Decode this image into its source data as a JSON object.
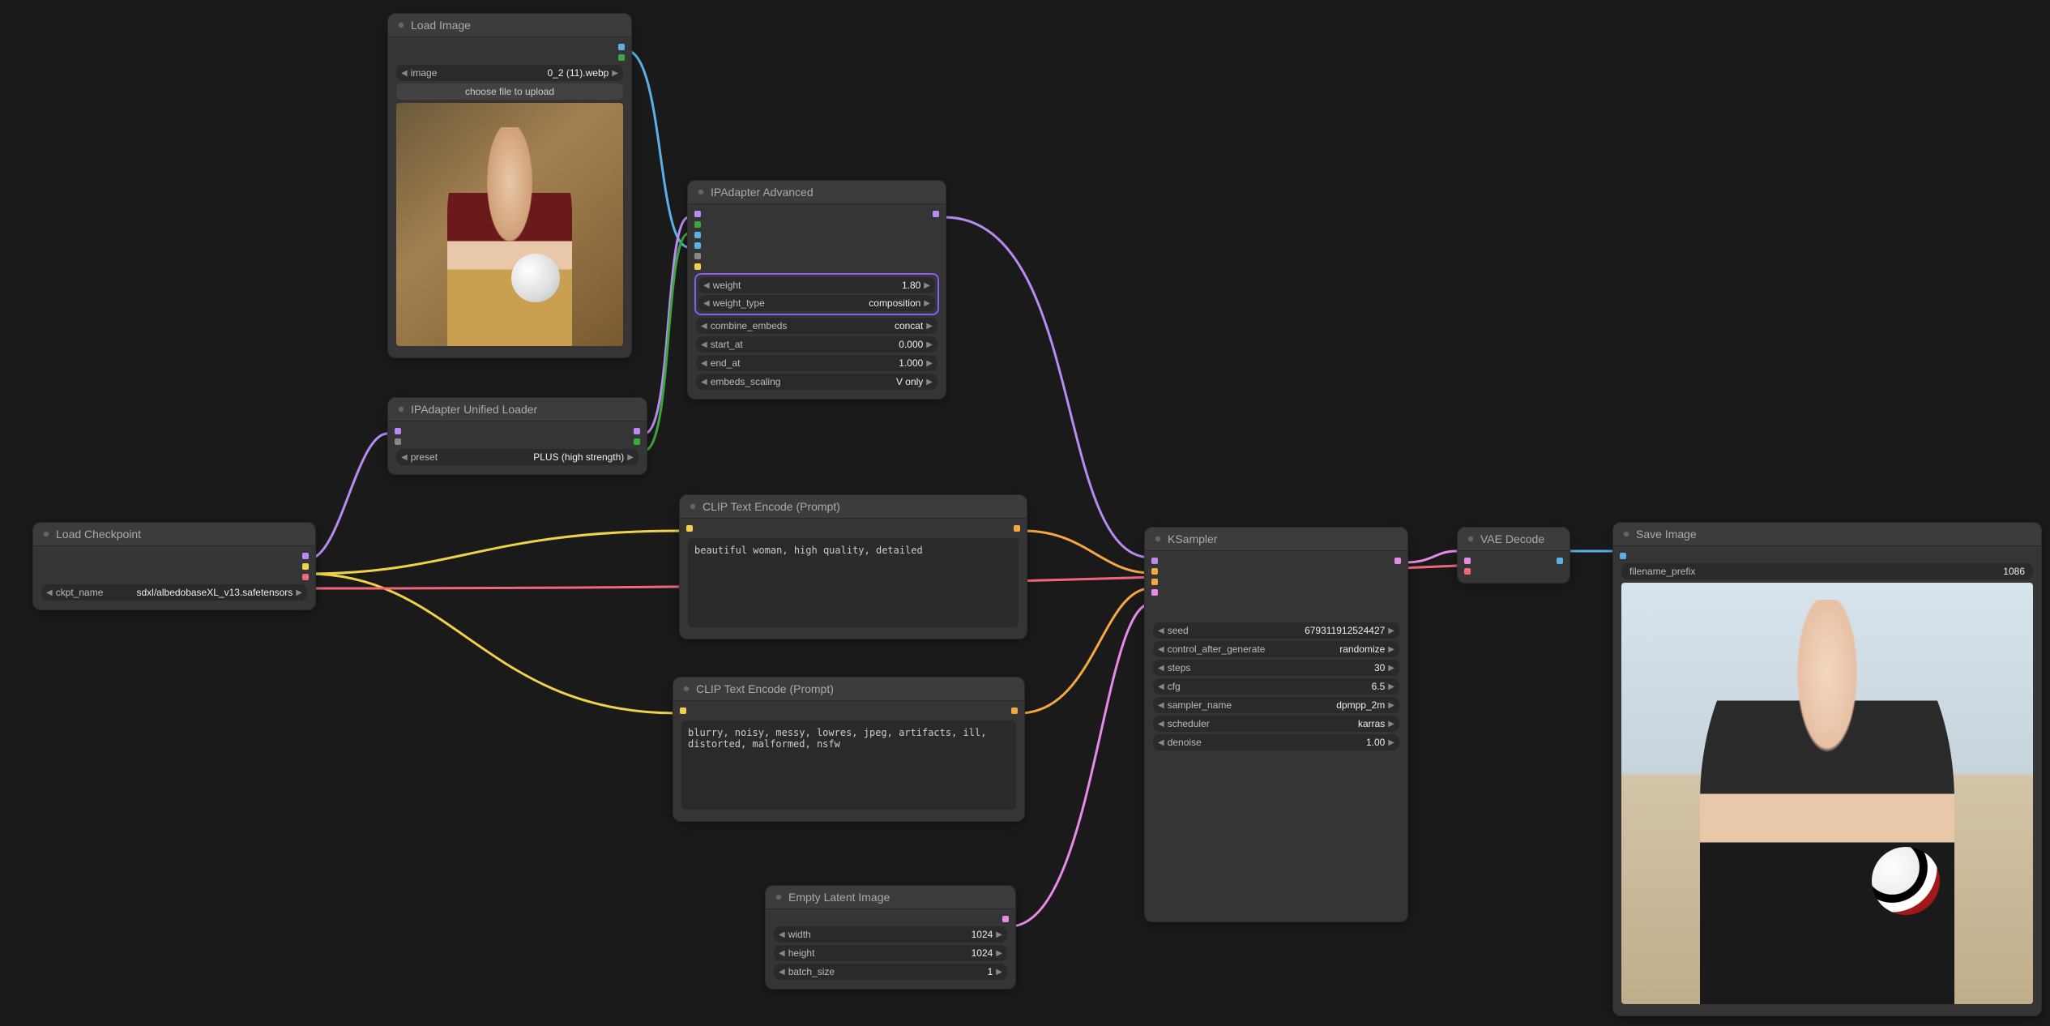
{
  "nodes": {
    "load_image": {
      "title": "Load Image",
      "image_label": "image",
      "image_value": "0_2 (11).webp",
      "upload_label": "choose file to upload"
    },
    "ipadapter_loader": {
      "title": "IPAdapter Unified Loader",
      "preset_label": "preset",
      "preset_value": "PLUS (high strength)"
    },
    "load_checkpoint": {
      "title": "Load Checkpoint",
      "ckpt_label": "ckpt_name",
      "ckpt_value": "sdxl/albedobaseXL_v13.safetensors"
    },
    "ipadapter_adv": {
      "title": "IPAdapter Advanced",
      "weight_label": "weight",
      "weight_value": "1.80",
      "weight_type_label": "weight_type",
      "weight_type_value": "composition",
      "combine_label": "combine_embeds",
      "combine_value": "concat",
      "start_label": "start_at",
      "start_value": "0.000",
      "end_label": "end_at",
      "end_value": "1.000",
      "scaling_label": "embeds_scaling",
      "scaling_value": "V only"
    },
    "clip_pos": {
      "title": "CLIP Text Encode (Prompt)",
      "text": "beautiful woman, high quality, detailed"
    },
    "clip_neg": {
      "title": "CLIP Text Encode (Prompt)",
      "text": "blurry, noisy, messy, lowres, jpeg, artifacts, ill, distorted, malformed, nsfw"
    },
    "empty_latent": {
      "title": "Empty Latent Image",
      "width_label": "width",
      "width_value": "1024",
      "height_label": "height",
      "height_value": "1024",
      "batch_label": "batch_size",
      "batch_value": "1"
    },
    "ksampler": {
      "title": "KSampler",
      "seed_label": "seed",
      "seed_value": "679311912524427",
      "cag_label": "control_after_generate",
      "cag_value": "randomize",
      "steps_label": "steps",
      "steps_value": "30",
      "cfg_label": "cfg",
      "cfg_value": "6.5",
      "sampler_label": "sampler_name",
      "sampler_value": "dpmpp_2m",
      "scheduler_label": "scheduler",
      "scheduler_value": "karras",
      "denoise_label": "denoise",
      "denoise_value": "1.00"
    },
    "vae_decode": {
      "title": "VAE Decode"
    },
    "save_image": {
      "title": "Save Image",
      "prefix_label": "filename_prefix",
      "prefix_value": "1086"
    }
  },
  "colors": {
    "model": "#b98bf2",
    "clip": "#f0d24a",
    "vae": "#f0687a",
    "image": "#5bb0e6",
    "ipadapter": "#3da63d",
    "conditioning_p": "#f5a742",
    "conditioning_n": "#f5a742",
    "latent": "#e88ae8",
    "combo": "#888"
  }
}
